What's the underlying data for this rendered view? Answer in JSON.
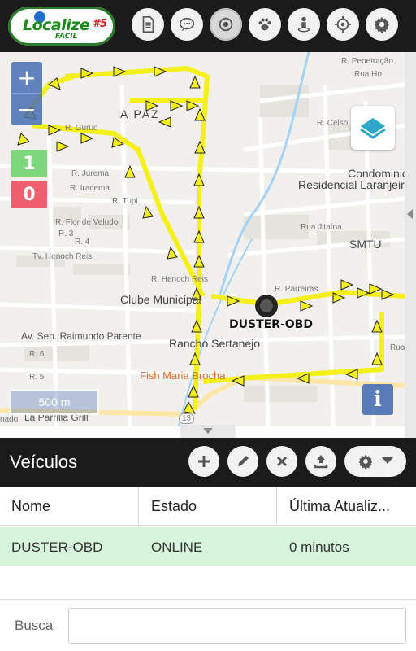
{
  "app": {
    "logo_text": "Localize",
    "logo_number": "#5",
    "logo_sub": "FÁCIL"
  },
  "toolbar": {
    "icons": [
      "document-icon",
      "chat-icon",
      "target-icon",
      "paw-icon",
      "person-pin-icon",
      "crosshair-icon",
      "gear-icon"
    ],
    "active": "target-icon"
  },
  "map": {
    "zoom_in": "+",
    "zoom_out": "−",
    "online_count": "1",
    "offline_count": "0",
    "vehicle_label": "DUSTER-OBD",
    "scale": "500 m",
    "info_label": "i",
    "route_color": "#f5ef1a",
    "places": {
      "condominio_1": "Condominio",
      "condominio_2": "Residencial Laranjeiras",
      "clube": "Clube Municipal",
      "avenida": "Av. Sen. Raimundo Parente",
      "rancho": "Rancho Sertanejo",
      "fish": "Fish Maria Brocha",
      "parrilla": "La Parrilla Grill",
      "smtu": "SMTU",
      "a_paz": "A PAZ",
      "r_jurema": "R. Jurema",
      "r_iracema": "R. Iracema",
      "r_tupi": "R. Tupi",
      "r_flor": "R. Flor de Veludo",
      "tv_henoch": "Tv. Henoch Reis",
      "r_henoch": "R. Henoch Reis",
      "rua_jitaina": "Rua Jitaína",
      "r_celso": "R. Celso M",
      "r_penetracao": "R. Penetração",
      "rua_ho": "Rua Ho",
      "r_guruo": "R. Guruo",
      "r_parreiras": "R. Parreiras",
      "r_3": "R. 3",
      "r_4": "R. 4",
      "r_6": "R. 6",
      "r_5": "R. 5",
      "nado": "nado",
      "rua": "Rua",
      "badge_13": "13"
    }
  },
  "vehicles": {
    "title": "Veículos",
    "actions": [
      "add-icon",
      "edit-icon",
      "delete-icon",
      "upload-icon",
      "settings-dropdown-icon"
    ],
    "columns": [
      "Nome",
      "Estado",
      "Última Atualiz..."
    ],
    "rows": [
      {
        "name": "DUSTER-OBD",
        "status": "ONLINE",
        "updated": "0 minutos"
      }
    ],
    "search_label": "Busca",
    "search_value": ""
  }
}
